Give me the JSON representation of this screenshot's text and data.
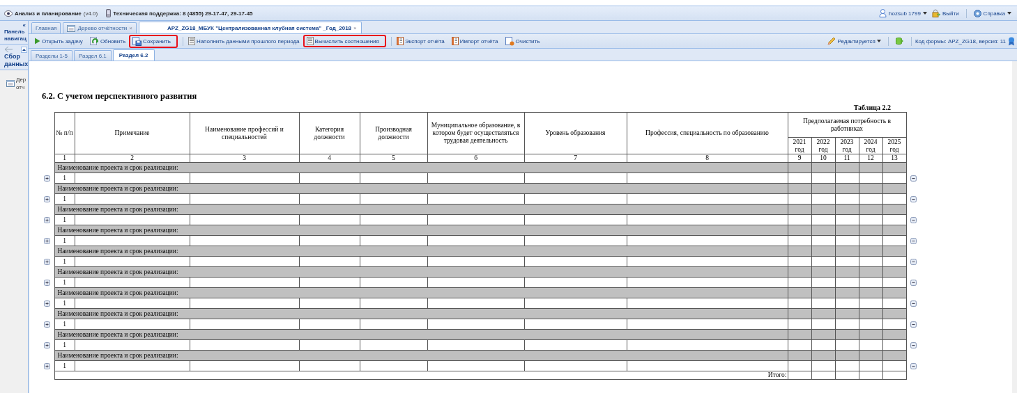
{
  "header": {
    "app_title": "Анализ и планирование",
    "app_version": "(v4.0)",
    "support": "Техническая поддержка: 8 (4855) 29-17-47, 29-17-45",
    "user": "hozsub 1799",
    "logout": "Выйти",
    "help": "Справка"
  },
  "nav_panel": {
    "collapse": "«",
    "title": "Панель навигац",
    "section": "Сбор данных",
    "item": "Дер отч"
  },
  "tabs": [
    {
      "label": "Главная",
      "selected": false
    },
    {
      "label": "Дерево отчётности",
      "close": "×",
      "selected": false
    },
    {
      "label": "APZ_ZG18_МБУК \"Централизованная клубная система\" _Год_2018",
      "close": "×",
      "selected": true
    }
  ],
  "toolbar": {
    "left": [
      {
        "label": "Открыть задачу",
        "separator_before": false,
        "highlighted": false
      },
      {
        "label": "Обновить",
        "separator_before": false,
        "highlighted": false
      },
      {
        "label": "Сохранить",
        "separator_before": false,
        "highlighted": true
      },
      {
        "label": "Наполнить данными прошлого периода",
        "separator_before": true,
        "highlighted": false
      },
      {
        "label": "Вычислить соотношения",
        "separator_before": false,
        "highlighted": true
      },
      {
        "label": "Экспорт отчёта",
        "separator_before": true,
        "highlighted": false
      },
      {
        "label": "Импорт отчёта",
        "separator_before": false,
        "highlighted": false
      },
      {
        "label": "Очистить",
        "separator_before": false,
        "highlighted": false
      }
    ],
    "status": "Редактируется",
    "form_code": "Код формы: APZ_ZG18, версия: 11"
  },
  "sub_tabs": [
    {
      "label": "Разделы 1-5",
      "selected": false
    },
    {
      "label": "Раздел 6.1",
      "selected": false
    },
    {
      "label": "Раздел 6.2",
      "selected": true
    }
  ],
  "report": {
    "title": "6.2. С учетом перспективного развития",
    "caption": "Таблица 2.2",
    "columns": [
      "№ п/п",
      "Примечание",
      "Наименование профессий и специальностей",
      "Категория должности",
      "Производная должности",
      "Муниципальное образование, в котором будет осуществляться трудовая деятельность",
      "Уровень образования",
      "Профессия, специальность по образованию"
    ],
    "group_header": "Предполагаемая потребность в работниках",
    "years": [
      "2021 год",
      "2022 год",
      "2023 год",
      "2024 год",
      "2025 год"
    ],
    "column_numbers": [
      "1",
      "2",
      "3",
      "4",
      "5",
      "6",
      "7",
      "8",
      "9",
      "10",
      "11",
      "12",
      "13"
    ],
    "groups": [
      {
        "label": "Наименование проекта и срок реализации:",
        "row_number": "1"
      },
      {
        "label": "Наименование проекта и срок реализации:",
        "row_number": "1"
      },
      {
        "label": "Наименование проекта и срок реализации:",
        "row_number": "1"
      },
      {
        "label": "Наименование проекта и срок реализации:",
        "row_number": "1"
      },
      {
        "label": "Наименование проекта и срок реализации:",
        "row_number": "1"
      },
      {
        "label": "Наименование проекта и срок реализации:",
        "row_number": "1"
      },
      {
        "label": "Наименование проекта и срок реализации:",
        "row_number": "1"
      },
      {
        "label": "Наименование проекта и срок реализации:",
        "row_number": "1"
      },
      {
        "label": "Наименование проекта и срок реализации:",
        "row_number": "1"
      },
      {
        "label": "Наименование проекта и срок реализации:",
        "row_number": "1"
      }
    ],
    "total_label": "Итого:"
  }
}
